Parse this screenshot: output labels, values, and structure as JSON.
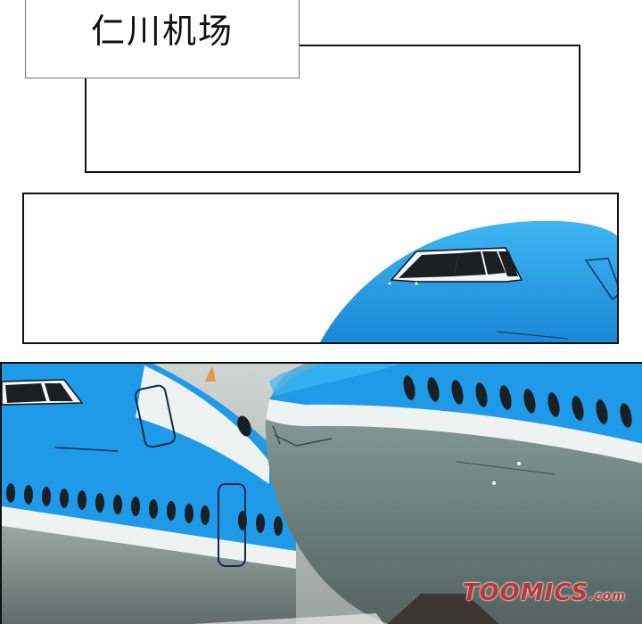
{
  "caption": {
    "text": "仁川机场"
  },
  "watermark": {
    "text": "TOOMICS",
    "suffix": ".com"
  },
  "colors": {
    "fuselage_blue": "#1f9ae8",
    "fuselage_light": "#3fb6f3",
    "belly_gray": "#8e9a95",
    "stripe_white": "#eef3f2",
    "watermark_red": "#c23434"
  }
}
